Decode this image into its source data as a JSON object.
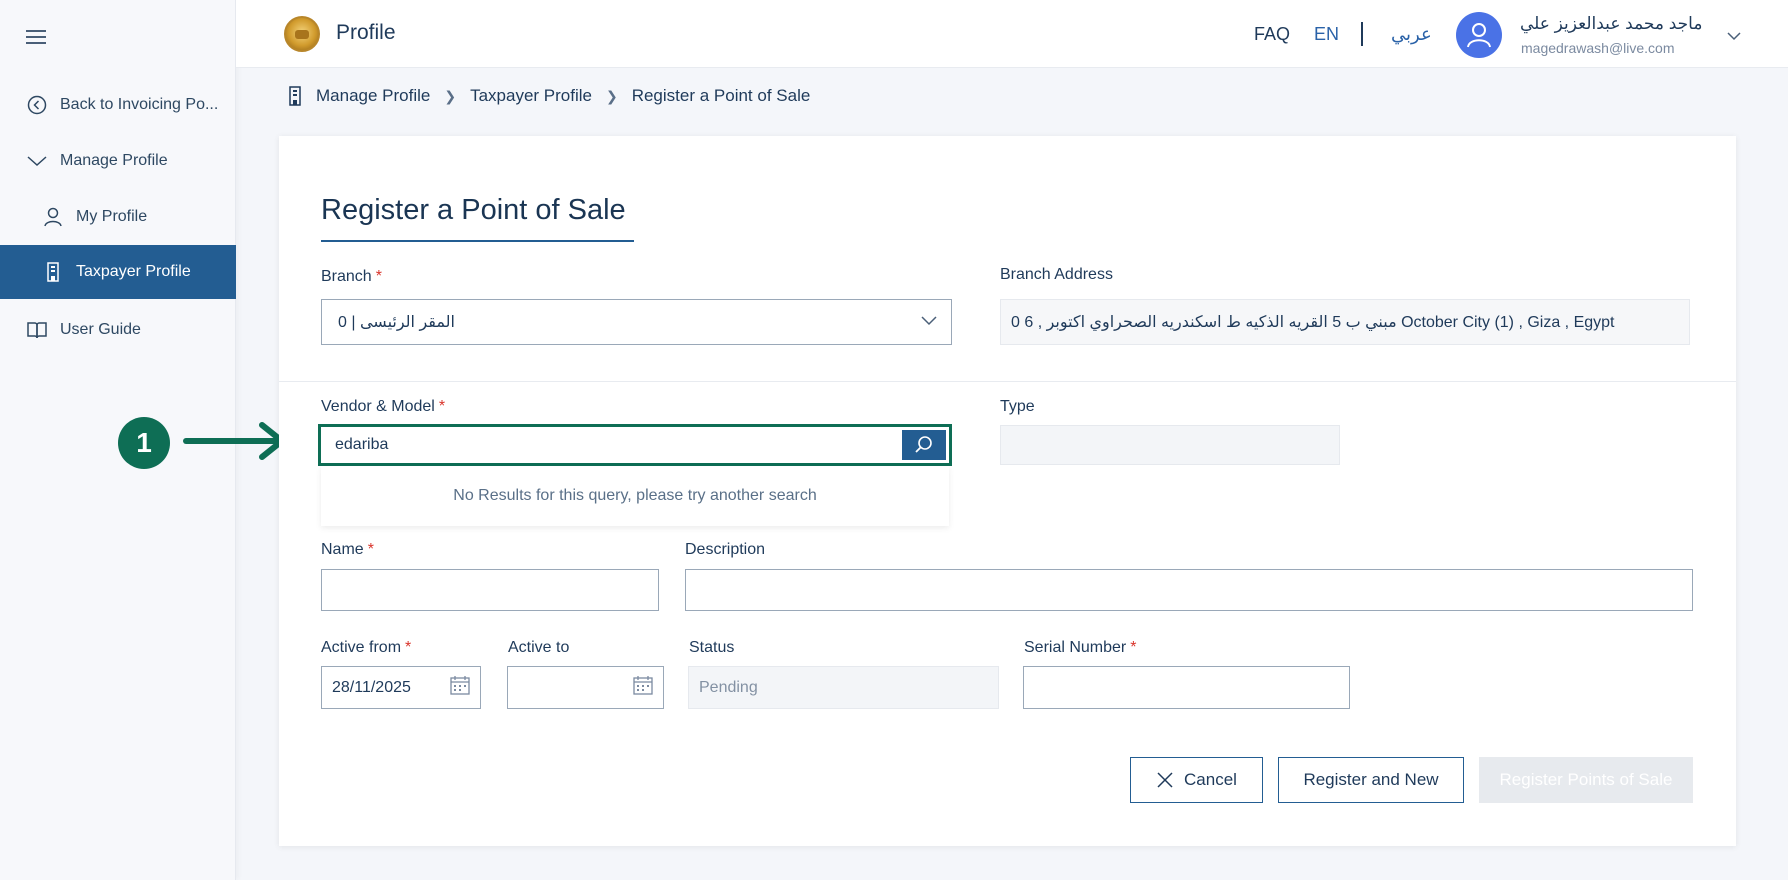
{
  "sidebar": {
    "items": [
      {
        "label": "Back to Invoicing Po..."
      },
      {
        "label": "Manage Profile"
      },
      {
        "label": "My Profile"
      },
      {
        "label": "Taxpayer Profile"
      },
      {
        "label": "User Guide"
      }
    ]
  },
  "header": {
    "title": "Profile",
    "faq": "FAQ",
    "lang_en": "EN",
    "lang_ar": "عربي",
    "user_name": "ماجد محمد عبدالعزيز علي",
    "user_email": "magedrawash@live.com"
  },
  "breadcrumb": [
    "Manage Profile",
    "Taxpayer Profile",
    "Register a Point of Sale"
  ],
  "form": {
    "title": "Register a Point of Sale",
    "branch_label": "Branch",
    "branch_value": "المقر الرئيسى | 0",
    "branch_address_label": "Branch Address",
    "branch_address_value": "0  6 , مبني ب 5 القريه الذكيه ط اسكندريه الصحراوي اكتوبر October City (1) , Giza , Egypt",
    "vendor_label": "Vendor & Model",
    "vendor_value": "edariba",
    "no_results": "No Results for this query, please try another search",
    "type_label": "Type",
    "name_label": "Name",
    "description_label": "Description",
    "active_from_label": "Active from",
    "active_from_value": "28/11/2025",
    "active_to_label": "Active to",
    "status_label": "Status",
    "status_value": "Pending",
    "serial_label": "Serial Number",
    "required_mark": "*"
  },
  "buttons": {
    "cancel": "Cancel",
    "register_new": "Register and New",
    "register_pos": "Register Points of Sale"
  },
  "annotation": {
    "step": "1"
  },
  "colors": {
    "primary": "#235d92",
    "accent_green": "#0e6e55",
    "required": "#d9342b"
  }
}
